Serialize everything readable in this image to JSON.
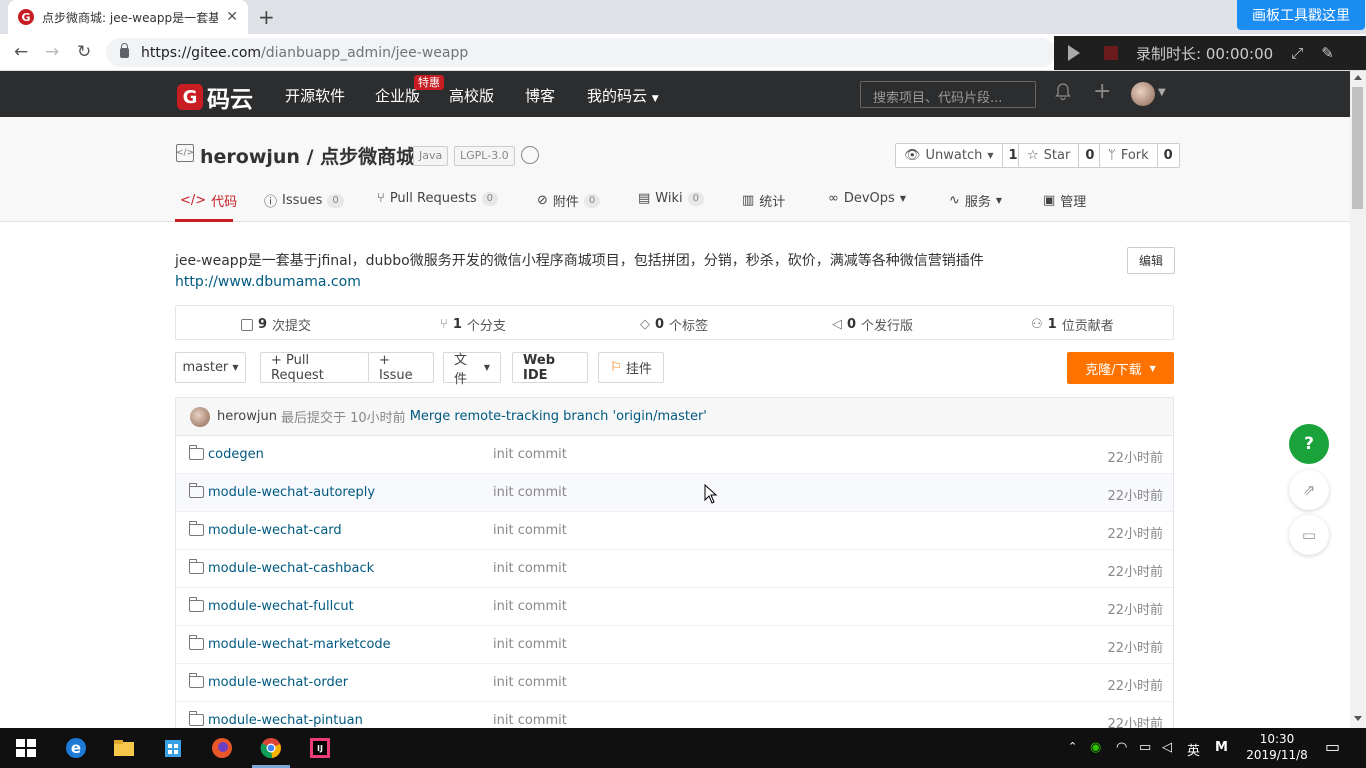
{
  "browser": {
    "tab_title": "点步微商城: jee-weapp是一套基于jfinal",
    "new_tab": "+",
    "tab_close": "✕",
    "url_host": "https://gitee.com",
    "url_path": "/dianbuapp_admin/jee-weapp"
  },
  "recorder": {
    "draw_tool": "画板工具戳这里",
    "label": "录制时长: 00:00:00"
  },
  "header": {
    "logo_text": "码云",
    "nav": [
      "开源软件",
      "企业版",
      "高校版",
      "博客",
      "我的码云"
    ],
    "badge": "特惠",
    "search_placeholder": "搜索项目、代码片段..."
  },
  "repo": {
    "owner_repo": "herowjun / 点步微商城",
    "tags": [
      "Java",
      "LGPL-3.0"
    ],
    "watch": {
      "label": "Unwatch",
      "count": "1"
    },
    "star": {
      "label": "Star",
      "count": "0"
    },
    "fork": {
      "label": "Fork",
      "count": "0"
    },
    "tabs": [
      {
        "label": "代码",
        "count": ""
      },
      {
        "label": "Issues",
        "count": "0"
      },
      {
        "label": "Pull Requests",
        "count": "0"
      },
      {
        "label": "附件",
        "count": "0"
      },
      {
        "label": "Wiki",
        "count": "0"
      },
      {
        "label": "统计",
        "count": ""
      },
      {
        "label": "DevOps",
        "count": ""
      },
      {
        "label": "服务",
        "count": ""
      },
      {
        "label": "管理",
        "count": ""
      }
    ],
    "description": "jee-weapp是一套基于jfinal，dubbo微服务开发的微信小程序商城项目，包括拼团，分销，秒杀，砍价，满减等各种微信营销插件",
    "homepage": "http://www.dbumama.com",
    "edit_label": "编辑"
  },
  "stats": [
    {
      "num": "9",
      "label": "次提交"
    },
    {
      "num": "1",
      "label": "个分支"
    },
    {
      "num": "0",
      "label": "个标签"
    },
    {
      "num": "0",
      "label": "个发行版"
    },
    {
      "num": "1",
      "label": "位贡献者"
    }
  ],
  "toolbar": {
    "branch": "master",
    "pull_request": "+ Pull Request",
    "issue": "+ Issue",
    "file": "文件",
    "web_ide": "Web IDE",
    "plugin": "挂件",
    "clone": "克隆/下载"
  },
  "last_commit": {
    "user": "herowjun",
    "text": "最后提交于",
    "time": "10小时前",
    "message": "Merge remote-tracking branch 'origin/master'"
  },
  "files": [
    {
      "name": "codegen",
      "msg": "init commit",
      "time": "22小时前"
    },
    {
      "name": "module-wechat-autoreply",
      "msg": "init commit",
      "time": "22小时前"
    },
    {
      "name": "module-wechat-card",
      "msg": "init commit",
      "time": "22小时前"
    },
    {
      "name": "module-wechat-cashback",
      "msg": "init commit",
      "time": "22小时前"
    },
    {
      "name": "module-wechat-fullcut",
      "msg": "init commit",
      "time": "22小时前"
    },
    {
      "name": "module-wechat-marketcode",
      "msg": "init commit",
      "time": "22小时前"
    },
    {
      "name": "module-wechat-order",
      "msg": "init commit",
      "time": "22小时前"
    },
    {
      "name": "module-wechat-pintuan",
      "msg": "init commit",
      "time": "22小时前"
    }
  ],
  "side": {
    "help": "?"
  },
  "taskbar": {
    "ime": "英",
    "ime_mode": "M",
    "time": "10:30",
    "date": "2019/11/8"
  },
  "colors": {
    "brand_red": "#c71d23",
    "clone_orange": "#fe7300",
    "header_dark": "#2c2d2e",
    "link_blue": "#005980",
    "help_green": "#1aa33a"
  }
}
